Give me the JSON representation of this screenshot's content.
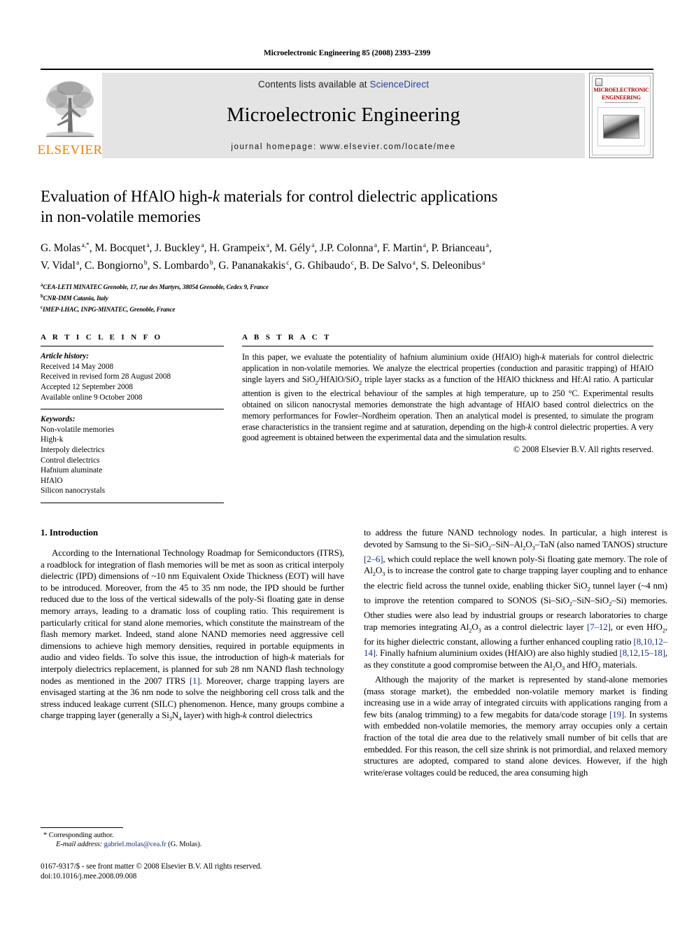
{
  "running_head": "Microelectronic Engineering 85 (2008) 2393–2399",
  "masthead": {
    "contents_prefix": "Contents lists available at ",
    "sciencedirect": "ScienceDirect",
    "journal_name": "Microelectronic Engineering",
    "homepage": "journal homepage: www.elsevier.com/locate/mee",
    "publisher_logo_text": "ELSEVIER",
    "cover_title_line1": "MICROELECTRONIC",
    "cover_title_line2": "ENGINEERING",
    "accent_orange": "#f08000",
    "link_blue": "#2b3f9e",
    "band_gray": "#e4e4e4"
  },
  "article": {
    "title_line1": "Evaluation of HfAlO high-k materials for control dielectric applications",
    "title_line2": "in non-volatile memories",
    "title_italic_token": "k",
    "authors_line1": "G. Molas a,*, M. Bocquet a, J. Buckley a, H. Grampeix a, M. Gély a, J.P. Colonna a, F. Martin a, P. Brianceau a,",
    "authors_line2": "V. Vidal a, C. Bongiorno b, S. Lombardo b, G. Pananakakis c, G. Ghibaudo c, B. De Salvo a, S. Deleonibus a",
    "affiliations": [
      {
        "marker": "a",
        "text": "CEA-LETI MINATEC Grenoble, 17, rue des Martyrs, 38054 Grenoble, Cedex 9, France"
      },
      {
        "marker": "b",
        "text": "CNR-IMM Catania, Italy"
      },
      {
        "marker": "c",
        "text": "IMEP-LHAC, INPG-MINATEC, Grenoble, France"
      }
    ]
  },
  "article_info": {
    "heading": "A R T I C L E    I N F O",
    "history_label": "Article history:",
    "history": [
      "Received 14 May 2008",
      "Received in revised form 28 August 2008",
      "Accepted 12 September 2008",
      "Available online 9 October 2008"
    ],
    "keywords_label": "Keywords:",
    "keywords": [
      "Non-volatile memories",
      "High-k",
      "Interpoly dielectrics",
      "Control dielectrics",
      "Hafnium aluminate",
      "HfAlO",
      "Silicon nanocrystals"
    ]
  },
  "abstract": {
    "heading": "A B S T R A C T",
    "text": "In this paper, we evaluate the potentiality of hafnium aluminium oxide (HfAlO) high-k materials for control dielectric application in non-volatile memories. We analyze the electrical properties (conduction and parasitic trapping) of HfAlO single layers and SiO2/HfAlO/SiO2 triple layer stacks as a function of the HfAlO thickness and Hf:Al ratio. A particular attention is given to the electrical behaviour of the samples at high temperature, up to 250 °C. Experimental results obtained on silicon nanocrystal memories demonstrate the high advantage of HfAlO based control dielectrics on the memory performances for Fowler–Nordheim operation. Then an analytical model is presented, to simulate the program erase characteristics in the transient regime and at saturation, depending on the high-k control dielectric properties. A very good agreement is obtained between the experimental data and the simulation results.",
    "copyright": "© 2008 Elsevier B.V. All rights reserved."
  },
  "introduction": {
    "heading": "1. Introduction",
    "left_paragraph": "According to the International Technology Roadmap for Semiconductors (ITRS), a roadblock for integration of flash memories will be met as soon as critical interpoly dielectric (IPD) dimensions of ~10 nm Equivalent Oxide Thickness (EOT) will have to be introduced. Moreover, from the 45 to 35 nm node, the IPD should be further reduced due to the loss of the vertical sidewalls of the poly-Si floating gate in dense memory arrays, leading to a dramatic loss of coupling ratio. This requirement is particularly critical for stand alone memories, which constitute the mainstream of the flash memory market. Indeed, stand alone NAND memories need aggressive cell dimensions to achieve high memory densities, required in portable equipments in audio and video fields. To solve this issue, the introduction of high-k materials for interpoly dielectrics replacement, is planned for sub 28 nm NAND flash technology nodes as mentioned in the 2007 ITRS [1]. Moreover, charge trapping layers are envisaged starting at the 36 nm node to solve the neighboring cell cross talk and the stress induced leakage current (SILC) phenomenon. Hence, many groups combine a charge trapping layer (generally a Si3N4 layer) with high-k control dielectrics",
    "right_paragraph_1": "to address the future NAND technology nodes. In particular, a high interest is devoted by Samsung to the Si–SiO2–SiN–Al2O3–TaN (also named TANOS) structure [2–6], which could replace the well known poly-Si floating gate memory. The role of Al2O3 is to increase the control gate to charge trapping layer coupling and to enhance the electric field across the tunnel oxide, enabling thicker SiO2 tunnel layer (~4 nm) to improve the retention compared to SONOS (Si–SiO2–SiN–SiO2–Si) memories. Other studies were also lead by industrial groups or research laboratories to charge trap memories integrating Al2O3 as a control dielectric layer [7–12], or even HfO2, for its higher dielectric constant, allowing a further enhanced coupling ratio [8,10,12–14]. Finally hafnium aluminium oxides (HfAlO) are also highly studied [8,12,15–18], as they constitute a good compromise between the Al2O3 and HfO2 materials.",
    "right_paragraph_2": "Although the majority of the market is represented by stand-alone memories (mass storage market), the embedded non-volatile memory market is finding increasing use in a wide array of integrated circuits with applications ranging from a few bits (analog trimming) to a few megabits for data/code storage [19]. In systems with embedded non-volatile memories, the memory array occupies only a certain fraction of the total die area due to the relatively small number of bit cells that are embedded. For this reason, the cell size shrink is not primordial, and relaxed memory structures are adopted, compared to stand alone devices. However, if the high write/erase voltages could be reduced, the area consuming high"
  },
  "footnotes": {
    "corresponding_marker": "*",
    "corresponding_label": "Corresponding author.",
    "email_label": "E-mail address:",
    "email": "gabriel.molas@cea.fr",
    "email_owner": "(G. Molas).",
    "issn_line": "0167-9317/$ - see front matter © 2008 Elsevier B.V. All rights reserved.",
    "doi_line": "doi:10.1016/j.mee.2008.09.008"
  }
}
